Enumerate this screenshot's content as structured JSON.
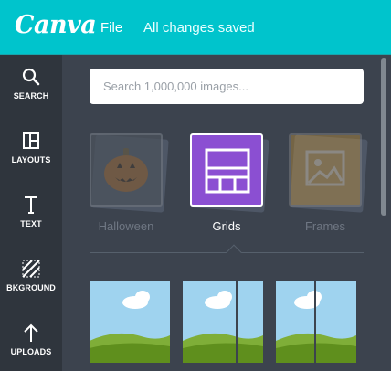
{
  "topbar": {
    "logo": "Canva",
    "file_label": "File",
    "status": "All changes saved"
  },
  "sidebar": {
    "items": [
      {
        "label": "SEARCH",
        "icon": "search-icon"
      },
      {
        "label": "LAYOUTS",
        "icon": "layouts-icon"
      },
      {
        "label": "TEXT",
        "icon": "text-icon"
      },
      {
        "label": "BKGROUND",
        "icon": "background-icon"
      },
      {
        "label": "UPLOADS",
        "icon": "upload-arrow-icon"
      }
    ],
    "active_index": 1
  },
  "panel": {
    "search": {
      "placeholder": "Search 1,000,000 images..."
    },
    "categories": [
      {
        "label": "Halloween",
        "icon": "pumpkin-icon",
        "selected": false
      },
      {
        "label": "Grids",
        "icon": "grid-icon",
        "selected": true
      },
      {
        "label": "Frames",
        "icon": "picture-frame-icon",
        "selected": false
      }
    ],
    "thumbnails": [
      {
        "name": "grid-single",
        "columns": 1
      },
      {
        "name": "grid-two-columns",
        "columns": 2
      },
      {
        "name": "grid-two-columns-alt",
        "columns": 2
      }
    ]
  },
  "colors": {
    "accent": "#00c4cc",
    "selected_tile": "#8b4fd2",
    "panel": "#3c434e",
    "sidebar": "#2f353d"
  }
}
